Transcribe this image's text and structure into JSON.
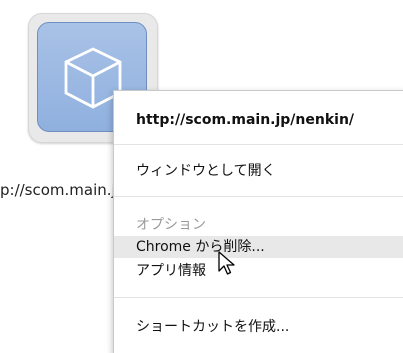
{
  "app": {
    "label": "p://scom.main.jp/nenkin/"
  },
  "menu": {
    "header_url": "http://scom.main.jp/nenkin/",
    "open_as_window": "ウィンドウとして開く",
    "options": "オプション",
    "remove_from_chrome": "Chrome から削除...",
    "app_info": "アプリ情報",
    "create_shortcut": "ショートカットを作成..."
  },
  "colors": {
    "icon_blue": "#8fb0de",
    "hover_gray": "#e8e8e8",
    "disabled_gray": "#9a9a9a"
  }
}
